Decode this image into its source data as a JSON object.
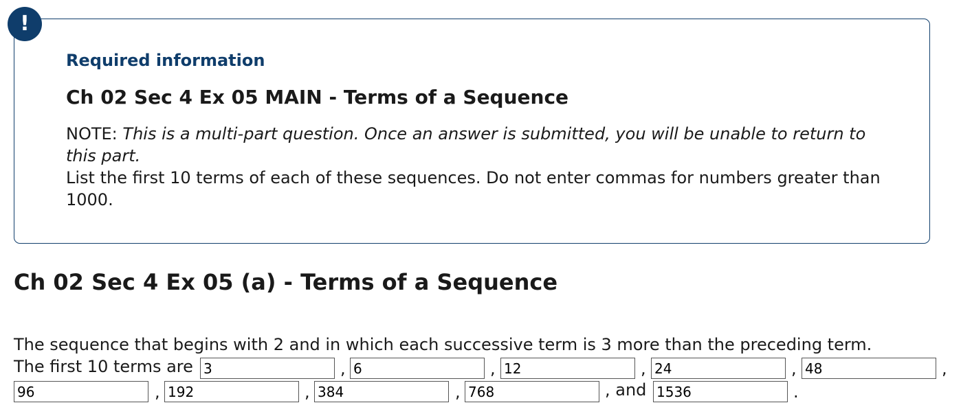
{
  "info": {
    "badge": "!",
    "required_label": "Required information",
    "title": "Ch 02 Sec 4 Ex 05 MAIN - Terms of a Sequence",
    "note_prefix": "NOTE:",
    "note_italic": "This is a multi-part question. Once an answer is submitted, you will be unable to return to this part.",
    "instruction": "List the first 10 terms of each of these sequences. Do not enter commas for numbers greater than 1000."
  },
  "part": {
    "title": "Ch 02 Sec 4 Ex 05 (a) - Terms of a Sequence",
    "question": "The sequence that begins with 2 and in which each successive term is 3 more than the preceding term.",
    "lead": "The first 10 terms are",
    "comma": ",",
    "and_text": ", and",
    "period": ".",
    "answers": [
      "3",
      "6",
      "12",
      "24",
      "48",
      "96",
      "192",
      "384",
      "768",
      "1536"
    ]
  }
}
